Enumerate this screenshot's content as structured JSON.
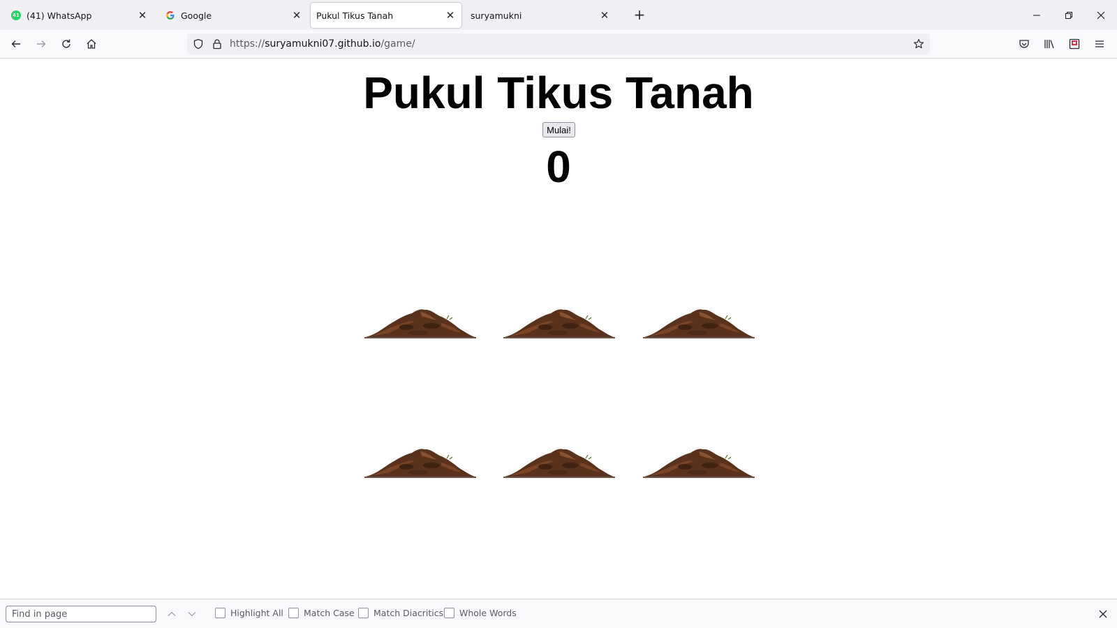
{
  "browser": {
    "tabs": [
      {
        "title": "(41) WhatsApp",
        "favicon": "whatsapp-icon",
        "badge": "41",
        "active": false
      },
      {
        "title": "Google",
        "favicon": "google-icon",
        "active": false
      },
      {
        "title": "Pukul Tikus Tanah",
        "favicon": "",
        "active": true
      },
      {
        "title": "suryamukni",
        "favicon": "",
        "active": false
      }
    ],
    "url_prefix": "https://",
    "url_host": "suryamukni07.github.io",
    "url_path": "/game/"
  },
  "game": {
    "title": "Pukul Tikus Tanah",
    "start_label": "Mulai!",
    "score": "0",
    "holes": [
      "hole-1",
      "hole-2",
      "hole-3",
      "hole-4",
      "hole-5",
      "hole-6"
    ],
    "dirt_color": "#5a321b"
  },
  "findbar": {
    "placeholder": "Find in page",
    "options": [
      {
        "label": "Highlight All",
        "checked": false
      },
      {
        "label": "Match Case",
        "checked": false
      },
      {
        "label": "Match Diacritics",
        "checked": false
      },
      {
        "label": "Whole Words",
        "checked": false
      }
    ]
  }
}
